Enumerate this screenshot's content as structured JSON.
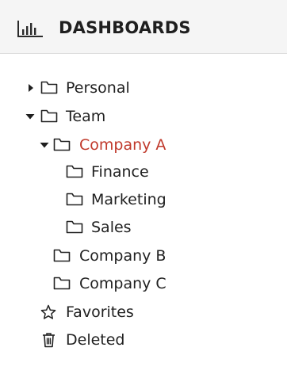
{
  "header": {
    "title": "DASHBOARDS",
    "icon": "bar-chart-icon"
  },
  "tree": {
    "personal": {
      "label": "Personal",
      "expanded": false
    },
    "team": {
      "label": "Team",
      "expanded": true
    },
    "company_a": {
      "label": "Company A",
      "expanded": true,
      "selected": true
    },
    "finance": {
      "label": "Finance"
    },
    "marketing": {
      "label": "Marketing"
    },
    "sales": {
      "label": "Sales"
    },
    "company_b": {
      "label": "Company B"
    },
    "company_c": {
      "label": "Company C"
    },
    "favorites": {
      "label": "Favorites",
      "icon": "star-icon"
    },
    "deleted": {
      "label": "Deleted",
      "icon": "trash-icon"
    }
  },
  "colors": {
    "accent": "#c0392b",
    "text": "#212121",
    "header_bg": "#f5f5f5"
  }
}
